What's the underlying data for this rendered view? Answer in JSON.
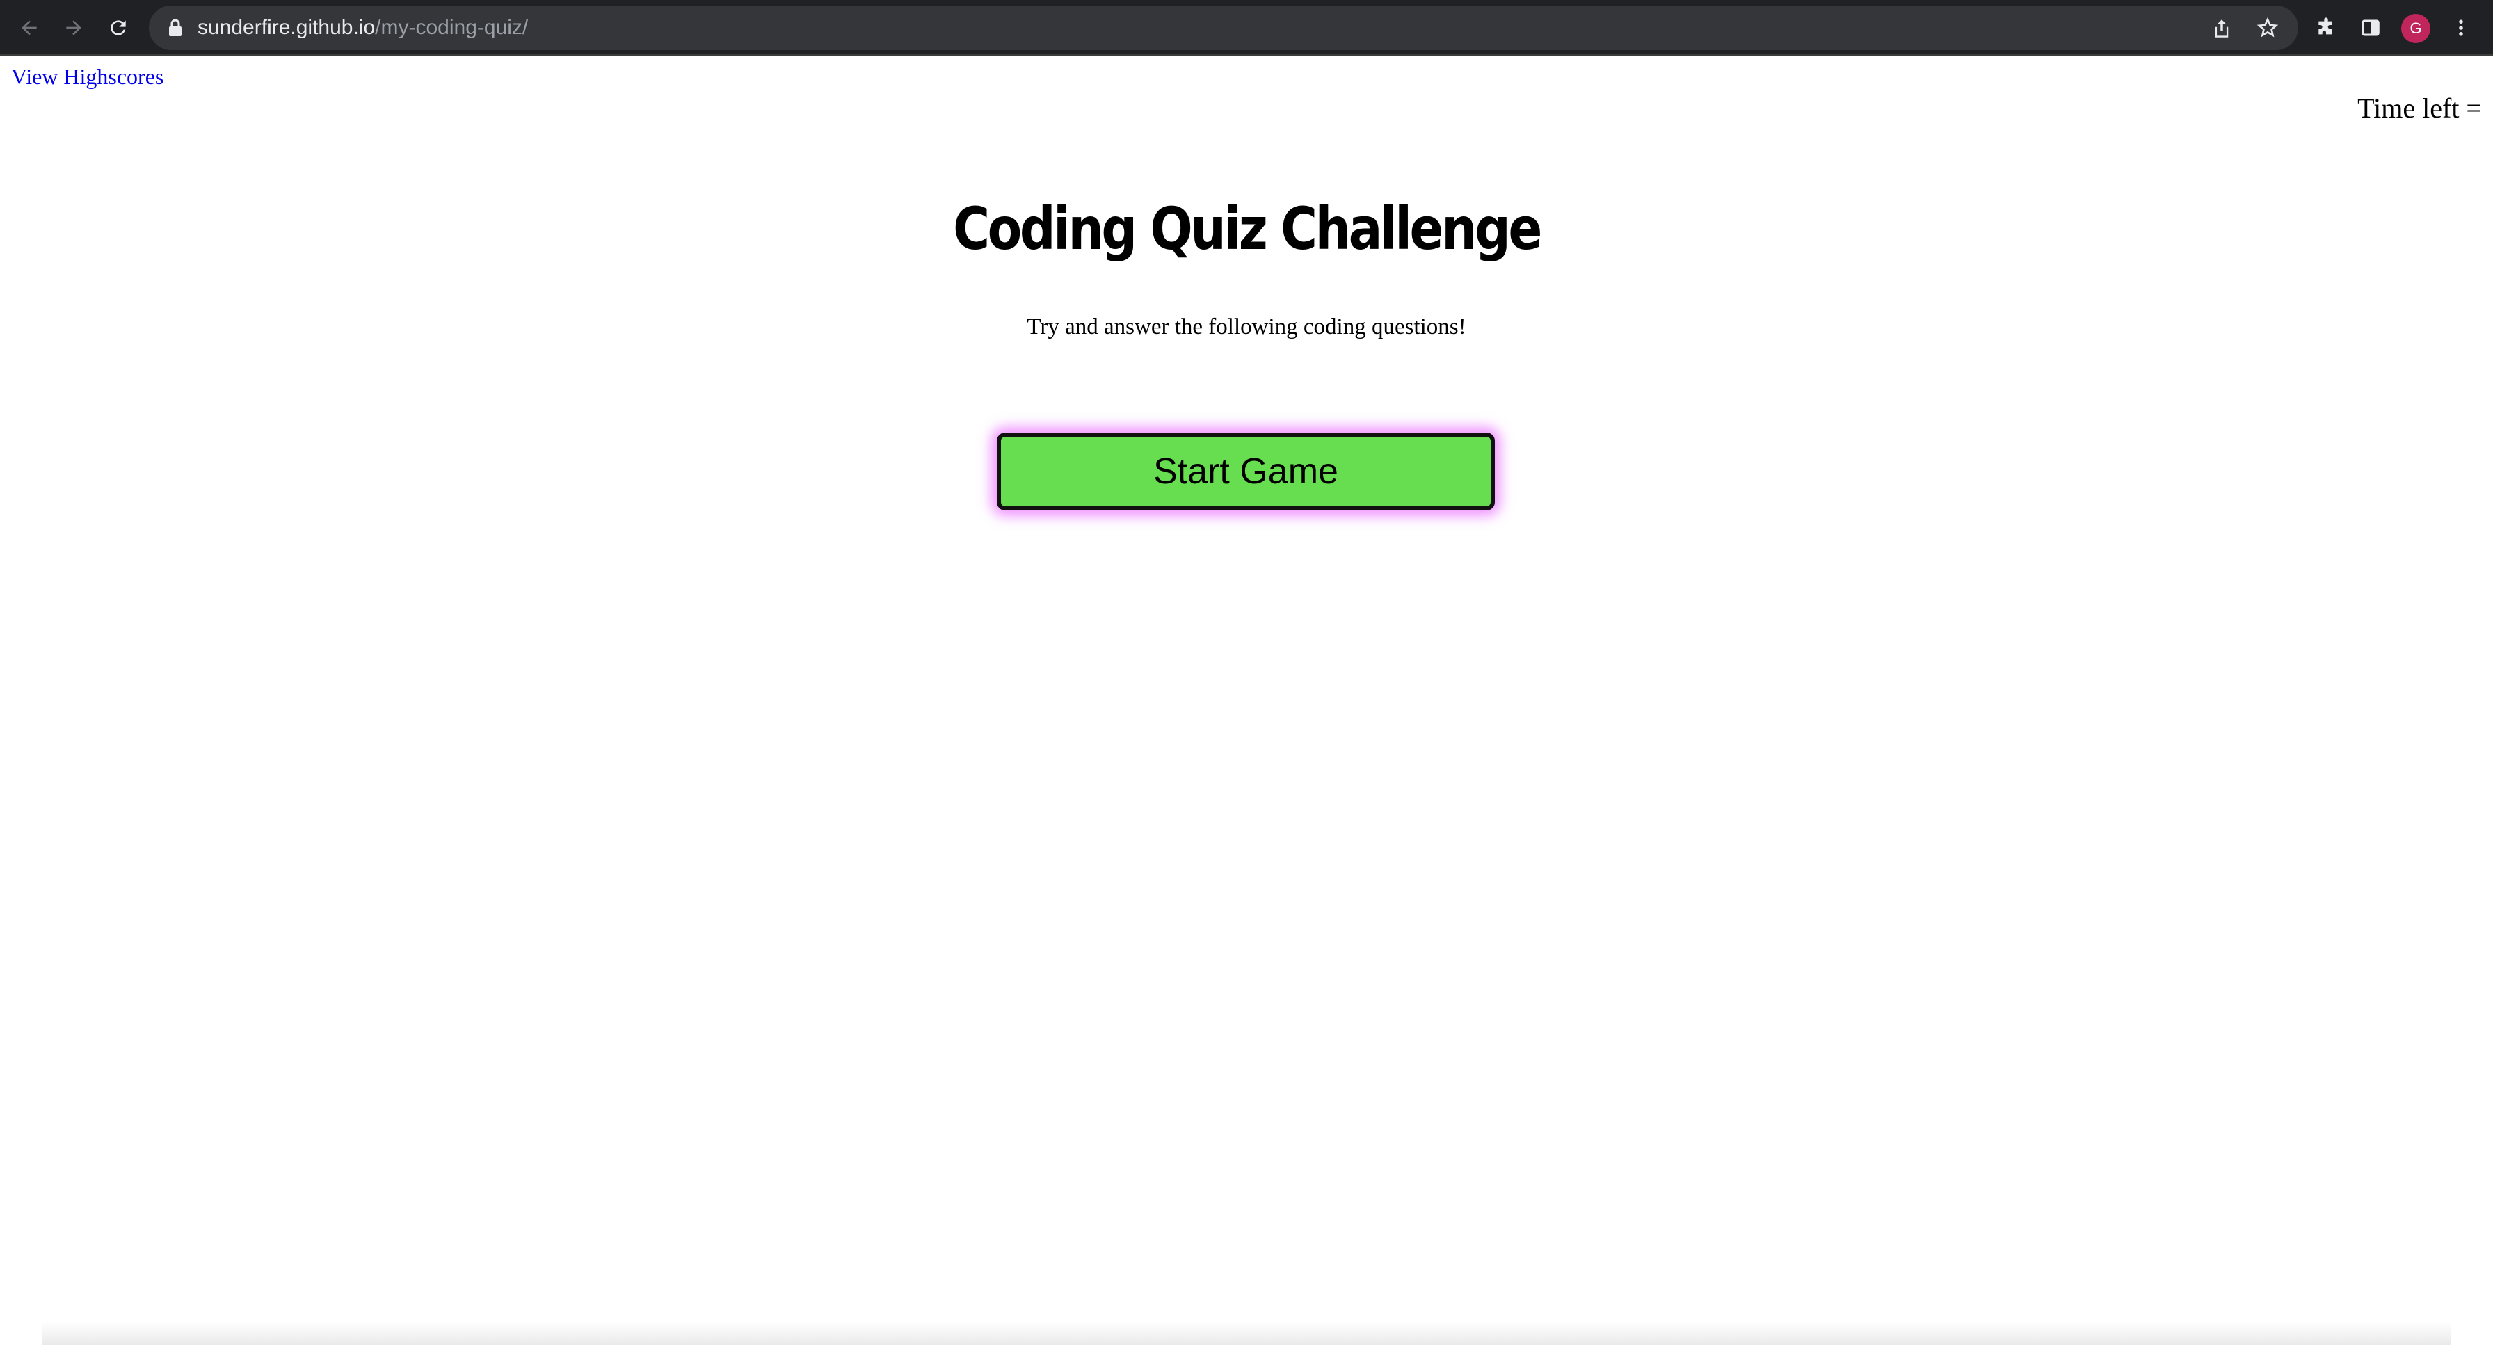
{
  "browser": {
    "url_host": "sunderfire.github.io",
    "url_path": "/my-coding-quiz/",
    "avatar_letter": "G",
    "avatar_color": "#c0265c",
    "icons": [
      "back-icon",
      "forward-icon",
      "reload-icon",
      "lock-icon",
      "share-icon",
      "star-icon",
      "extensions-icon",
      "side-panel-icon",
      "menu-icon"
    ]
  },
  "page": {
    "highscores_link": "View Highscores",
    "time_left_label": "Time left =",
    "title": "Coding Quiz Challenge",
    "subtitle": "Try and answer the following coding questions!",
    "start_button": "Start Game",
    "colors": {
      "start_button_bg": "#67de4f",
      "start_button_glow": "#ec82ff",
      "link": "#0000ee"
    }
  }
}
